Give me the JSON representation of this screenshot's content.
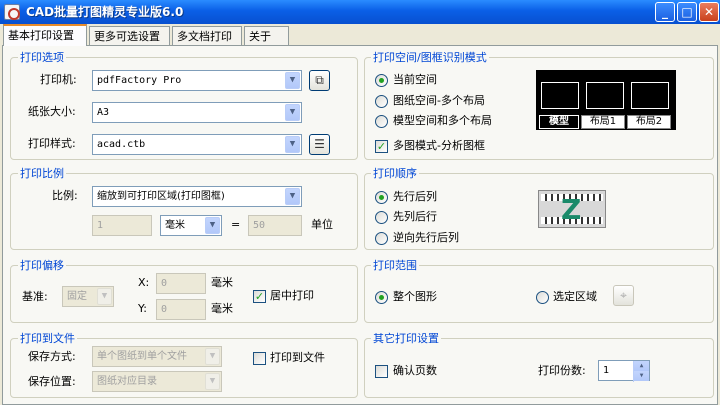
{
  "window": {
    "title": "CAD批量打图精灵专业版6.0",
    "controls": {
      "minimize": "_",
      "maximize": "□",
      "close": "✕"
    }
  },
  "tabs": [
    "基本打印设置",
    "更多可选设置",
    "多文档打印",
    "关于"
  ],
  "print_options": {
    "title": "打印选项",
    "printer_label": "打印机:",
    "printer_value": "pdfFactory Pro",
    "paper_label": "纸张大小:",
    "paper_value": "A3",
    "style_label": "打印样式:",
    "style_value": "acad.ctb"
  },
  "space_mode": {
    "title": "打印空间/图框识别模式",
    "options": [
      "当前空间",
      "图纸空间-多个布局",
      "模型空间和多个布局"
    ],
    "selected": 0,
    "preview_tabs": [
      "模型",
      "布局1",
      "布局2"
    ],
    "multi_frame_label": "多图模式-分析图框",
    "multi_frame_checked": true
  },
  "scale": {
    "title": "打印比例",
    "scale_label": "比例:",
    "scale_value": "缩放到可打印区域(打印图框)",
    "left_value": "1",
    "unit_value": "毫米",
    "equals": "=",
    "right_value": "50",
    "unit_label": "单位"
  },
  "order": {
    "title": "打印顺序",
    "options": [
      "先行后列",
      "先列后行",
      "逆向先行后列"
    ],
    "selected": 0,
    "icon_glyph": "Z"
  },
  "offset": {
    "title": "打印偏移",
    "base_label": "基准:",
    "base_value": "固定",
    "x_label": "X:",
    "x_value": "0",
    "x_unit": "毫米",
    "y_label": "Y:",
    "y_value": "0",
    "y_unit": "毫米",
    "center_label": "居中打印",
    "center_checked": true
  },
  "range": {
    "title": "打印范围",
    "whole_label": "整个图形",
    "selection_label": "选定区域",
    "selected": 0
  },
  "to_file": {
    "title": "打印到文件",
    "save_mode_label": "保存方式:",
    "save_mode_value": "单个图纸到单个文件",
    "save_loc_label": "保存位置:",
    "save_loc_value": "图纸对应目录",
    "print_to_file_label": "打印到文件",
    "print_to_file_checked": false
  },
  "other": {
    "title": "其它打印设置",
    "confirm_pages_label": "确认页数",
    "confirm_pages_checked": false,
    "copies_label": "打印份数:",
    "copies_value": "1"
  },
  "colors": {
    "titlebar": "#0a5fe6",
    "group_title": "#0046d5",
    "radio_dot": "#21a121",
    "active_tab_accent": "#e68b2c"
  }
}
